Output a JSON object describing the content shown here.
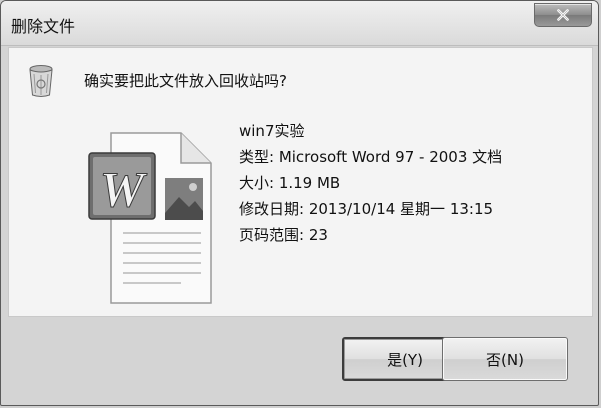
{
  "window": {
    "title": "删除文件",
    "close_icon": "close-icon"
  },
  "dialog": {
    "question": "确实要把此文件放入回收站吗?",
    "file": {
      "name": "win7实验",
      "type": "类型: Microsoft Word 97 - 2003 文档",
      "size": "大小: 1.19 MB",
      "modified": "修改日期: 2013/10/14 星期一 13:15",
      "pages": "页码范围: 23"
    },
    "icons": {
      "bin": "recycle-bin-icon",
      "document": "word-document-icon",
      "word_letter": "W"
    }
  },
  "buttons": {
    "yes": "是(Y)",
    "no": "否(N)"
  }
}
